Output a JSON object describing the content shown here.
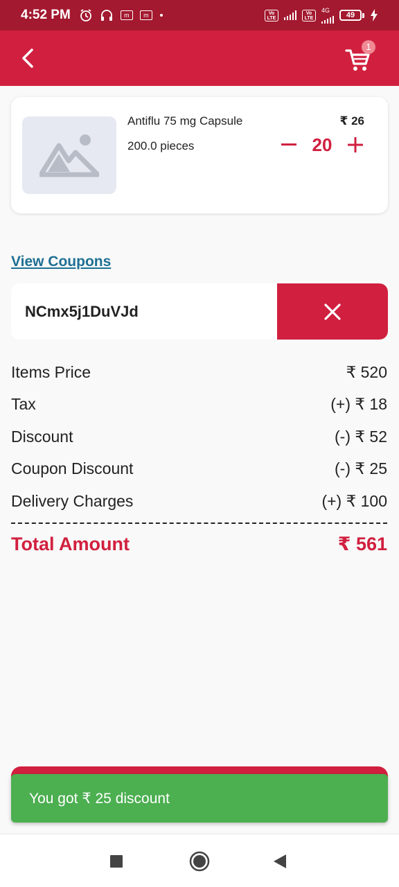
{
  "status_bar": {
    "time": "4:52 PM",
    "notification_icons": [
      "alarm-icon",
      "headset-icon",
      "app-notification-icon",
      "app-notification-icon",
      "dot-icon"
    ],
    "volte_label": "Vo LTE",
    "network_type": "4G",
    "battery_level": "49",
    "charging": true
  },
  "app_bar": {
    "background": "#d1203f",
    "cart_badge_count": "1"
  },
  "product": {
    "name": "Antiflu 75 mg Capsule",
    "quantity_text": "200.0 pieces",
    "price": "₹ 26",
    "quantity": "20",
    "decrease_symbol": "—",
    "increase_symbol": "+"
  },
  "coupon": {
    "view_coupons_label": "View Coupons",
    "code": "NCmx5j1DuVJd"
  },
  "summary": {
    "rows": [
      {
        "label": "Items Price",
        "value": "₹ 520"
      },
      {
        "label": "Tax",
        "value": "(+) ₹ 18"
      },
      {
        "label": "Discount",
        "value": "(-) ₹ 52"
      },
      {
        "label": "Coupon Discount",
        "value": "(-) ₹ 25"
      },
      {
        "label": "Delivery Charges",
        "value": "(+) ₹ 100"
      }
    ],
    "total_label": "Total Amount",
    "total_value": "₹ 561"
  },
  "snackbar": {
    "message": "You got ₹ 25 discount",
    "color": "#4caf50"
  },
  "colors": {
    "accent": "#d1203f",
    "status_bar": "#a3192f",
    "link": "#1d6f93"
  }
}
